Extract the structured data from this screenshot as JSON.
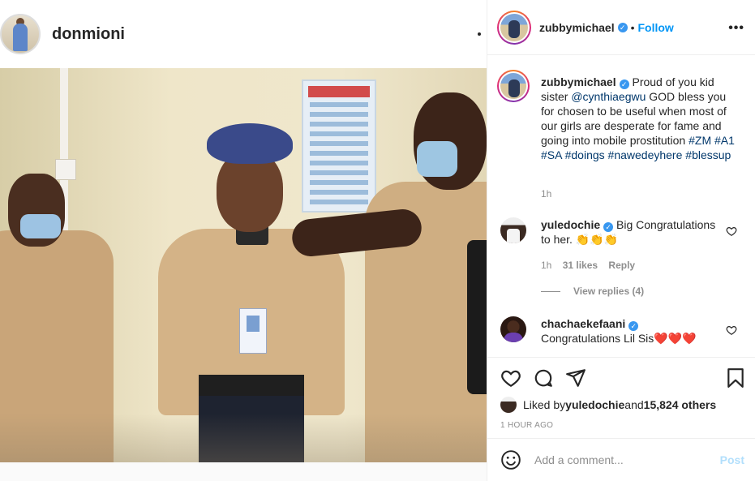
{
  "background_post": {
    "username": "donmioni"
  },
  "panel": {
    "author": "zubbymichael",
    "follow_label": "Follow",
    "separator": "•",
    "more_label": "•••"
  },
  "caption": {
    "username": "zubbymichael",
    "text_before_mention": "Proud of you kid sister ",
    "mention": "@cynthiaegwu",
    "text_after_mention": " GOD bless you for chosen to be useful when most of our girls are desperate for fame and going into mobile prostitution ",
    "hashtags": [
      "#ZM",
      "#A1",
      "#SA",
      "#doings",
      "#nawedeyhere",
      "#blessup"
    ],
    "time": "1h"
  },
  "comments": [
    {
      "username": "yuledochie",
      "text": "Big Congratulations to her. 👏👏👏",
      "time": "1h",
      "likes": "31 likes",
      "reply_label": "Reply",
      "view_replies": "View replies (4)"
    },
    {
      "username": "chachaekefaani",
      "text": "Congratulations Lil Sis❤️❤️❤️"
    }
  ],
  "actions": {
    "liked_by_prefix": "Liked by ",
    "liked_by_user": "yuledochie",
    "liked_by_mid": " and ",
    "liked_by_count": "15,824 others",
    "post_time": "1 HOUR AGO"
  },
  "add_comment": {
    "placeholder": "Add a comment...",
    "post_label": "Post"
  },
  "colors": {
    "link": "#00376b",
    "accent": "#0095f6",
    "verified": "#3897f0",
    "post_disabled": "#b2dffc"
  }
}
